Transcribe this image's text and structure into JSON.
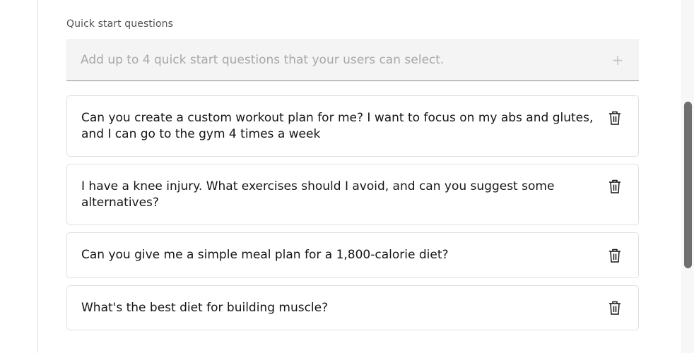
{
  "quick_start": {
    "label": "Quick start questions",
    "add_placeholder": "Add up to 4 quick start questions that your users can select.",
    "add_icon": "plus-icon"
  },
  "questions": [
    {
      "text": "Can you create a custom workout plan for me? I want to focus on my abs and glutes, and I can go to the gym 4 times a week",
      "delete_icon": "trash-icon"
    },
    {
      "text": "I have a knee injury. What exercises should I avoid, and can you suggest some alternatives?",
      "delete_icon": "trash-icon"
    },
    {
      "text": "Can you give me a simple meal plan for a 1,800-calorie diet?",
      "delete_icon": "trash-icon"
    },
    {
      "text": "What's the best diet for building muscle?",
      "delete_icon": "trash-icon"
    }
  ],
  "colors": {
    "text": "#161616",
    "placeholder": "#a8a8a8",
    "field_bg": "#f4f4f4",
    "card_border": "#e0e0e0",
    "scroll_thumb": "#6f6f6f"
  }
}
